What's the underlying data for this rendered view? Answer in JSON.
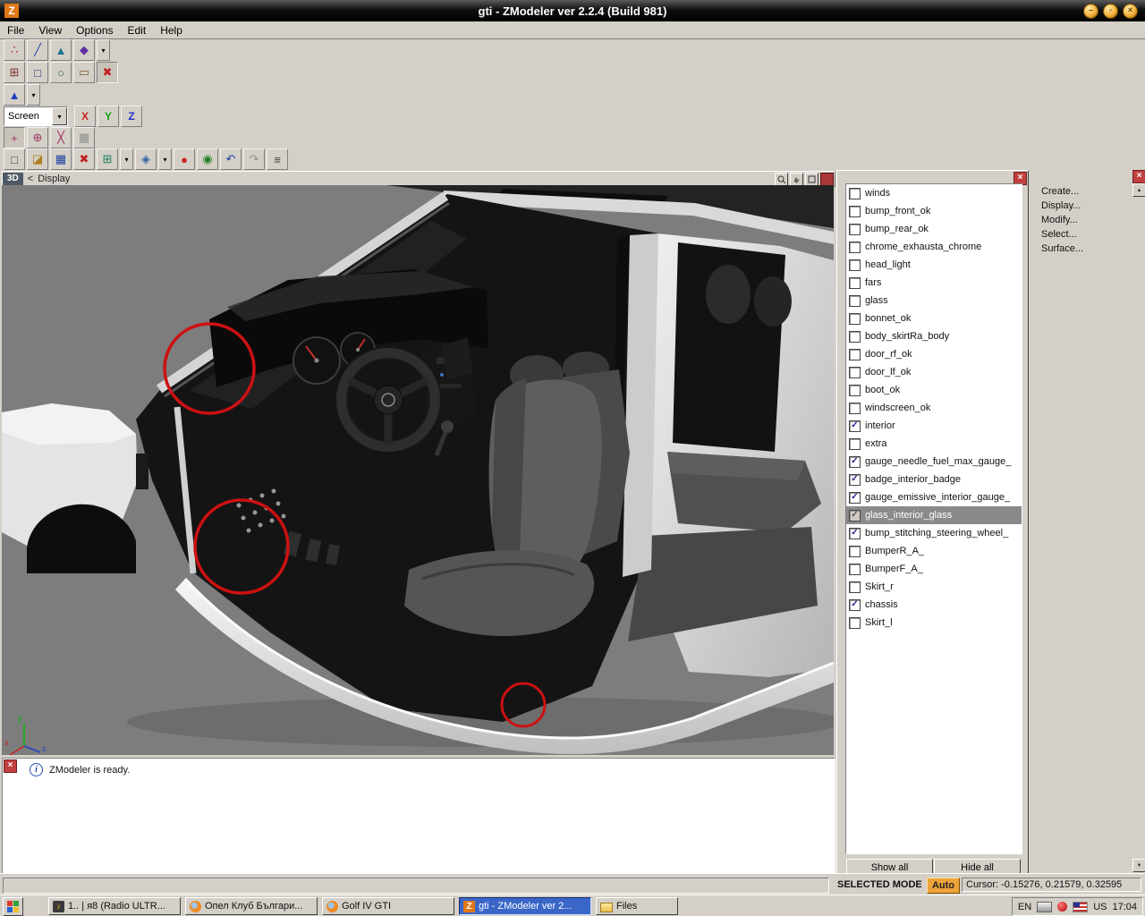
{
  "window": {
    "title": "gti - ZModeler ver 2.2.4 (Build 981)",
    "logo_letter": "Z",
    "controls": {
      "minimize": "–",
      "maximize": "▫",
      "close": "×"
    }
  },
  "menu": {
    "items": [
      {
        "label": "File"
      },
      {
        "label": "View"
      },
      {
        "label": "Options"
      },
      {
        "label": "Edit"
      },
      {
        "label": "Help"
      }
    ]
  },
  "toolbars": {
    "row1": [
      {
        "name": "vertices-mode-icon",
        "glyph": "∴",
        "color": "#a02020"
      },
      {
        "name": "edges-mode-icon",
        "glyph": "╱",
        "color": "#2040a0"
      },
      {
        "name": "polygons-mode-icon",
        "glyph": "▲",
        "color": "#207090"
      },
      {
        "name": "objects-mode-icon",
        "glyph": "◆",
        "color": "#6030a0"
      },
      {
        "name": "modes-dropdown-icon",
        "glyph": "▾",
        "color": "#000000"
      }
    ],
    "row2": [
      {
        "name": "select-quad-icon",
        "glyph": "⊞",
        "color": "#803030"
      },
      {
        "name": "select-single-icon",
        "glyph": "□",
        "color": "#303080"
      },
      {
        "name": "select-circle-icon",
        "glyph": "○",
        "color": "#306030"
      },
      {
        "name": "select-poly-icon",
        "glyph": "▭",
        "color": "#806030"
      },
      {
        "name": "select-invert-icon",
        "glyph": "✖",
        "color": "#c02020",
        "pressed": true
      }
    ],
    "row3": [
      {
        "name": "view-cone-icon",
        "glyph": "▲",
        "color": "#2040c0"
      },
      {
        "name": "view-dropdown-icon",
        "glyph": "▾",
        "color": "#000000"
      }
    ],
    "row4": {
      "view_combo": "Screen",
      "axes": [
        {
          "label": "X",
          "color": "#c82222"
        },
        {
          "label": "Y",
          "color": "#16a016"
        },
        {
          "label": "Z",
          "color": "#2233cc"
        }
      ]
    },
    "row5": [
      {
        "name": "edit-move-icon",
        "glyph": "+",
        "color": "#a03060",
        "pressed": true
      },
      {
        "name": "edit-rotate-icon",
        "glyph": "⊕",
        "color": "#a03060"
      },
      {
        "name": "edit-scale-icon",
        "glyph": "╳",
        "color": "#a03060"
      },
      {
        "name": "edit-extra-icon",
        "glyph": "▦",
        "color": "#909090"
      }
    ],
    "row6": [
      {
        "name": "new-file-icon",
        "glyph": "□",
        "color": "#404040"
      },
      {
        "name": "open-file-icon",
        "glyph": "◪",
        "color": "#b08020"
      },
      {
        "name": "save-file-icon",
        "glyph": "▦",
        "color": "#2040a0"
      },
      {
        "name": "delete-icon",
        "glyph": "✖",
        "color": "#c02020"
      },
      {
        "name": "clone-icon",
        "glyph": "⊞",
        "color": "#208060"
      },
      {
        "name": "clone-dropdown-icon",
        "glyph": "▾",
        "color": "#000000"
      },
      {
        "name": "import-icon",
        "glyph": "◈",
        "color": "#3060a0"
      },
      {
        "name": "import-dropdown-icon",
        "glyph": "▾",
        "color": "#000000"
      },
      {
        "name": "record-icon",
        "glyph": "●",
        "color": "#d02020"
      },
      {
        "name": "snapshot-icon",
        "glyph": "◉",
        "color": "#208020"
      },
      {
        "name": "undo-icon",
        "glyph": "↶",
        "color": "#2040a0"
      },
      {
        "name": "redo-icon",
        "glyph": "↷",
        "color": "#909090"
      },
      {
        "name": "script-icon",
        "glyph": "≡",
        "color": "#404040"
      }
    ]
  },
  "viewport": {
    "mode_tab": "3D",
    "back_arrow": "<",
    "view_name": "Display"
  },
  "hierarchy": {
    "items": [
      {
        "label": "winds",
        "checked": false
      },
      {
        "label": "bump_front_ok",
        "checked": false
      },
      {
        "label": "bump_rear_ok",
        "checked": false
      },
      {
        "label": "chrome_exhausta_chrome",
        "checked": false
      },
      {
        "label": "head_light",
        "checked": false
      },
      {
        "label": "fars",
        "checked": false
      },
      {
        "label": "glass",
        "checked": false
      },
      {
        "label": "bonnet_ok",
        "checked": false
      },
      {
        "label": "body_skirtRa_body",
        "checked": false
      },
      {
        "label": "door_rf_ok",
        "checked": false
      },
      {
        "label": "door_lf_ok",
        "checked": false
      },
      {
        "label": "boot_ok",
        "checked": false
      },
      {
        "label": "windscreen_ok",
        "checked": false
      },
      {
        "label": "interior",
        "checked": true
      },
      {
        "label": "extra",
        "checked": false
      },
      {
        "label": "gauge_needle_fuel_max_gauge_",
        "checked": true
      },
      {
        "label": "badge_interior_badge",
        "checked": true
      },
      {
        "label": "gauge_emissive_interior_gauge_",
        "checked": true
      },
      {
        "label": "glass_interior_glass",
        "checked": true,
        "selected": true
      },
      {
        "label": "bump_stitching_steering_wheel_",
        "checked": true
      },
      {
        "label": "BumperR_A_",
        "checked": false
      },
      {
        "label": "BumperF_A_",
        "checked": false
      },
      {
        "label": "Skirt_r",
        "checked": false
      },
      {
        "label": "chassis",
        "checked": true
      },
      {
        "label": "Skirt_l",
        "checked": false
      }
    ],
    "show_all": "Show all",
    "hide_all": "Hide all"
  },
  "command_panel": {
    "items": [
      "Create...",
      "Display...",
      "Modify...",
      "Select...",
      "Surface..."
    ]
  },
  "log": {
    "message": "ZModeler is ready."
  },
  "status": {
    "mode": "SELECTED MODE",
    "auto": "Auto",
    "cursor": "Cursor: -0.15276, 0.21579, 0.32595"
  },
  "taskbar": {
    "items": [
      {
        "label": "1.. | я8 (Radio ULTR...",
        "icon": "winamp-icon"
      },
      {
        "label": "Опел Клуб Българи...",
        "icon": "firefox-icon"
      },
      {
        "label": "Golf IV GTI",
        "icon": "firefox-icon"
      },
      {
        "label": "gti - ZModeler ver 2...",
        "icon": "zmodeler-icon",
        "active": true
      },
      {
        "label": "Files",
        "icon": "folder-icon",
        "narrow": true
      }
    ],
    "tray": {
      "lang": "EN",
      "layout": "US",
      "time": "17:04"
    }
  }
}
